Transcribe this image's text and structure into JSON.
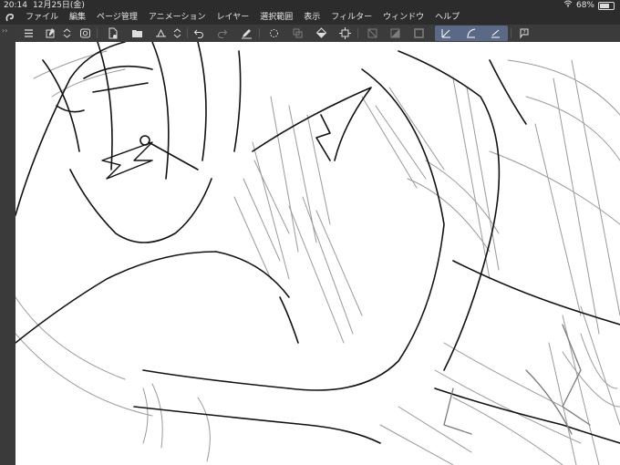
{
  "status": {
    "time": "20:14",
    "date": "12月25日(金)",
    "wifi_icon": "wifi-icon",
    "battery": "68%",
    "battery_level": 0.68
  },
  "menu": {
    "logo_icon": "clip-studio-logo-icon",
    "items": [
      "ファイル",
      "編集",
      "ページ管理",
      "アニメーション",
      "レイヤー",
      "選択範囲",
      "表示",
      "フィルター",
      "ウィンドウ",
      "ヘルプ"
    ]
  },
  "toolbar": {
    "icons": [
      "menu-icon",
      "new-layer-icon",
      "layer-order-icon",
      "copy-icon",
      "new-file-icon",
      "open-file-icon",
      "save-icon",
      "export-icon",
      "undo-icon",
      "redo-icon",
      "pen-icon",
      "transform-icon",
      "fill-icon",
      "select-icon",
      "crop-icon",
      "clear-icon",
      "fill-selection-icon",
      "stroke-icon",
      "ruler-straight-icon",
      "ruler-curve-icon",
      "ruler-line-icon",
      "help-icon"
    ],
    "selected_group_color": "#5a6a86"
  },
  "left_strip": {
    "arrows": "››"
  },
  "canvas": {
    "background": "#ffffff",
    "line_color": "#111111",
    "sketch_color": "#9a9a9a"
  }
}
